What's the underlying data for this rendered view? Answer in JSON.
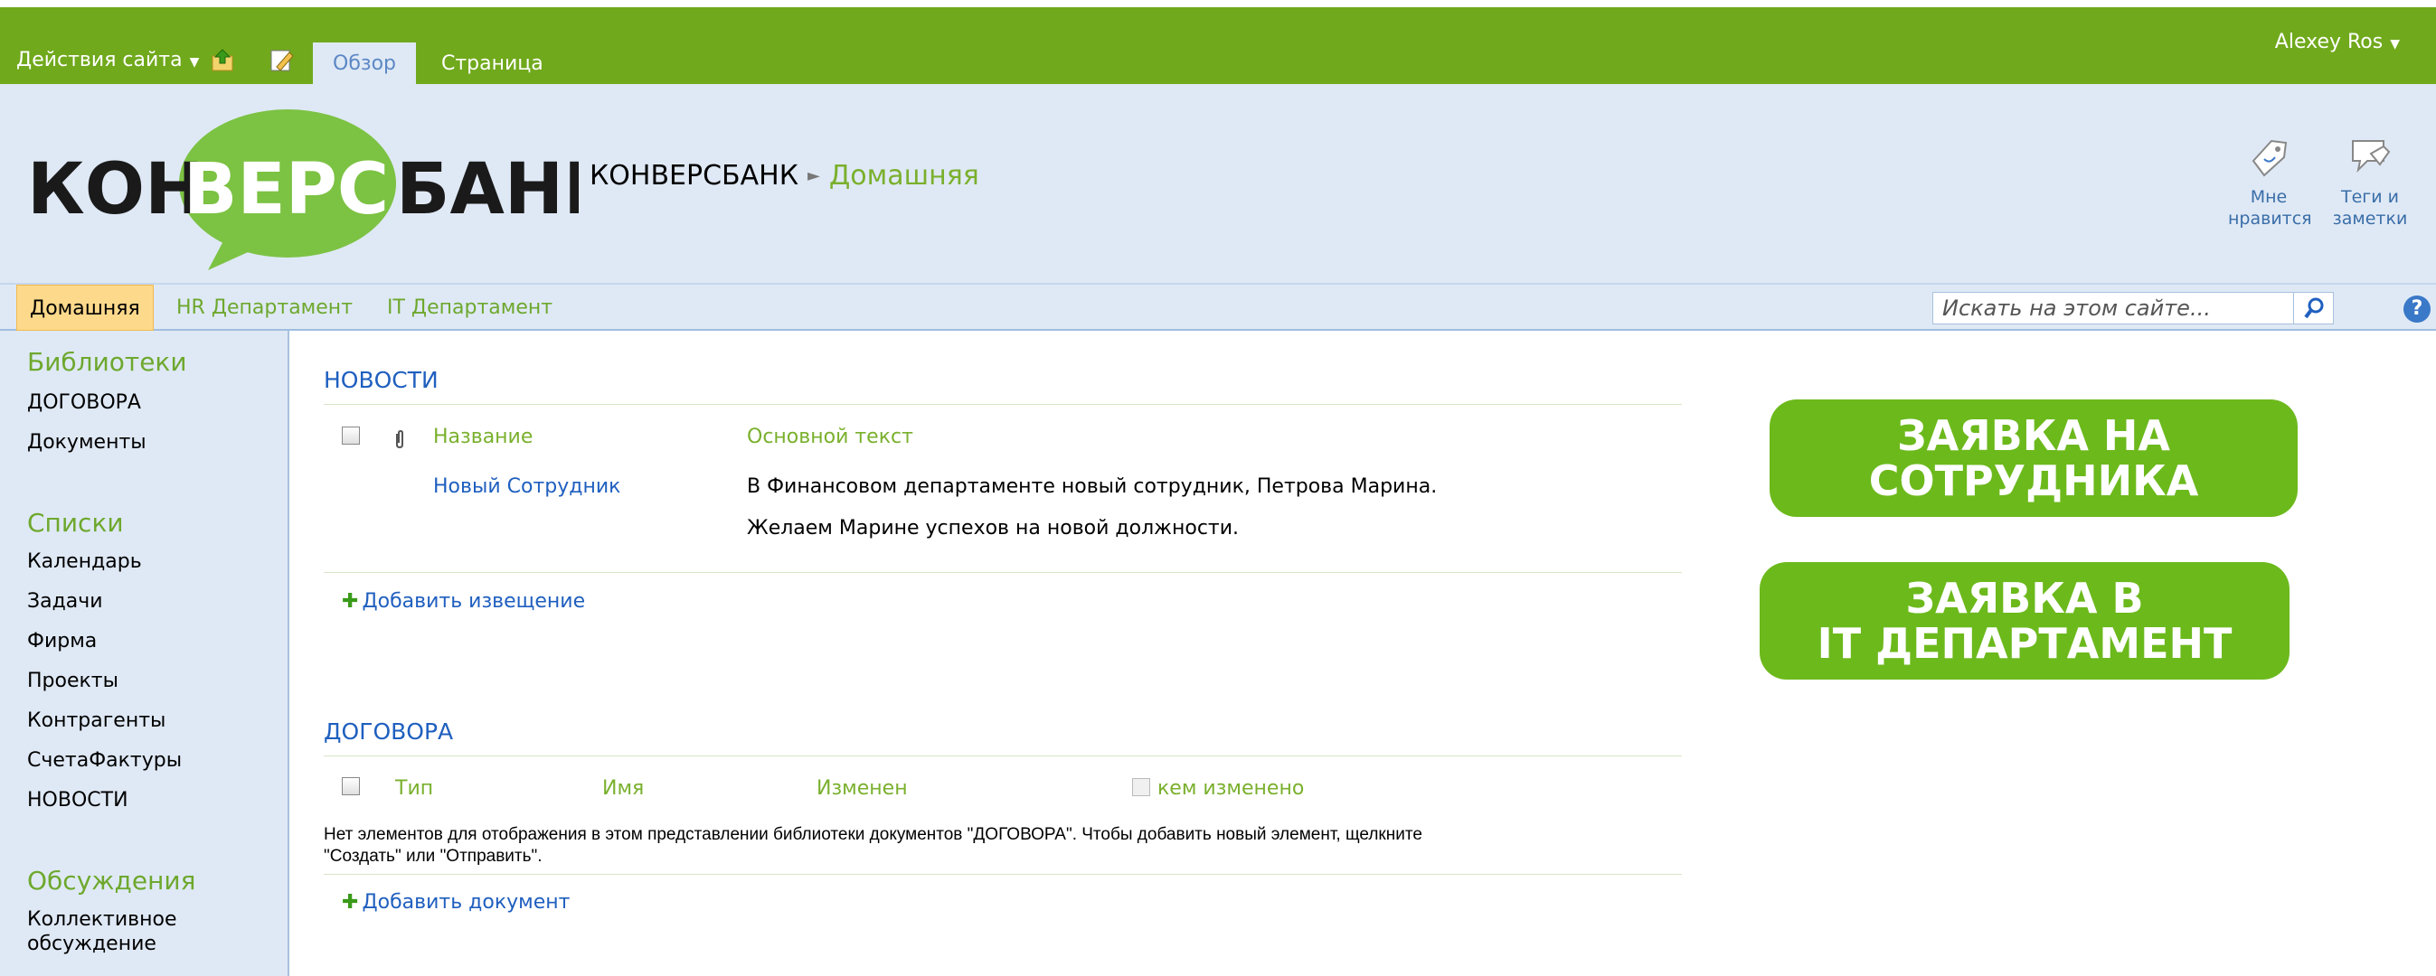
{
  "ribbon": {
    "site_actions": "Действия сайта",
    "tabs": [
      {
        "label": "Обзор",
        "active": true
      },
      {
        "label": "Страница",
        "active": false
      }
    ],
    "user": "Alexey Ros",
    "color": "#70a91c"
  },
  "header": {
    "logo_text_left": "КОН",
    "logo_text_bubble": "ВЕРС",
    "logo_text_right": "БАНК",
    "breadcrumb_site": "КОНВЕРСБАНК",
    "breadcrumb_current": "Домашняя",
    "social": [
      {
        "line1": "Мне",
        "line2": "нравится",
        "icon": "like-tag-icon"
      },
      {
        "line1": "Теги и",
        "line2": "заметки",
        "icon": "tags-notes-icon"
      }
    ]
  },
  "topnav": {
    "items": [
      {
        "label": "Домашняя",
        "active": true
      },
      {
        "label": "HR Департамент",
        "active": false
      },
      {
        "label": "IT Департамент",
        "active": false
      }
    ],
    "search_placeholder": "Искать на этом сайте..."
  },
  "leftnav": {
    "libraries_head": "Библиотеки",
    "libraries": [
      "ДОГОВОРА",
      "Документы"
    ],
    "lists_head": "Списки",
    "lists": [
      "Календарь",
      "Задачи",
      "Фирма",
      "Проекты",
      "Контрагенты",
      "СчетаФактуры",
      "НОВОСТИ"
    ],
    "discussions_head": "Обсуждения",
    "discussions_line1": "Коллективное",
    "discussions_line2": "обсуждение"
  },
  "news": {
    "title": "НОВОСТИ",
    "col_name": "Название",
    "col_body": "Основной текст",
    "row_name": "Новый Сотрудник",
    "row_body_line1": "В Финансовом департаменте новый сотрудник, Петрова Марина.",
    "row_body_line2": "Желаем Марине успехов на новой должности.",
    "add": "Добавить извещение"
  },
  "contracts": {
    "title": "ДОГОВОРА",
    "col_type": "Тип",
    "col_name": "Имя",
    "col_modified": "Изменен",
    "col_modified_by": "кем изменено",
    "empty_line1": "Нет элементов для отображения в этом представлении библиотеки документов \"ДОГОВОРА\". Чтобы добавить новый элемент, щелкните",
    "empty_line2": "\"Создать\" или \"Отправить\".",
    "add": "Добавить документ"
  },
  "buttons": {
    "employee_line1": "ЗАЯВКА НА",
    "employee_line2": "СОТРУДНИКА",
    "it_line1": "ЗАЯВКА В",
    "it_line2": "IT ДЕПАРТАМЕНТ",
    "color": "#6cb91c"
  }
}
